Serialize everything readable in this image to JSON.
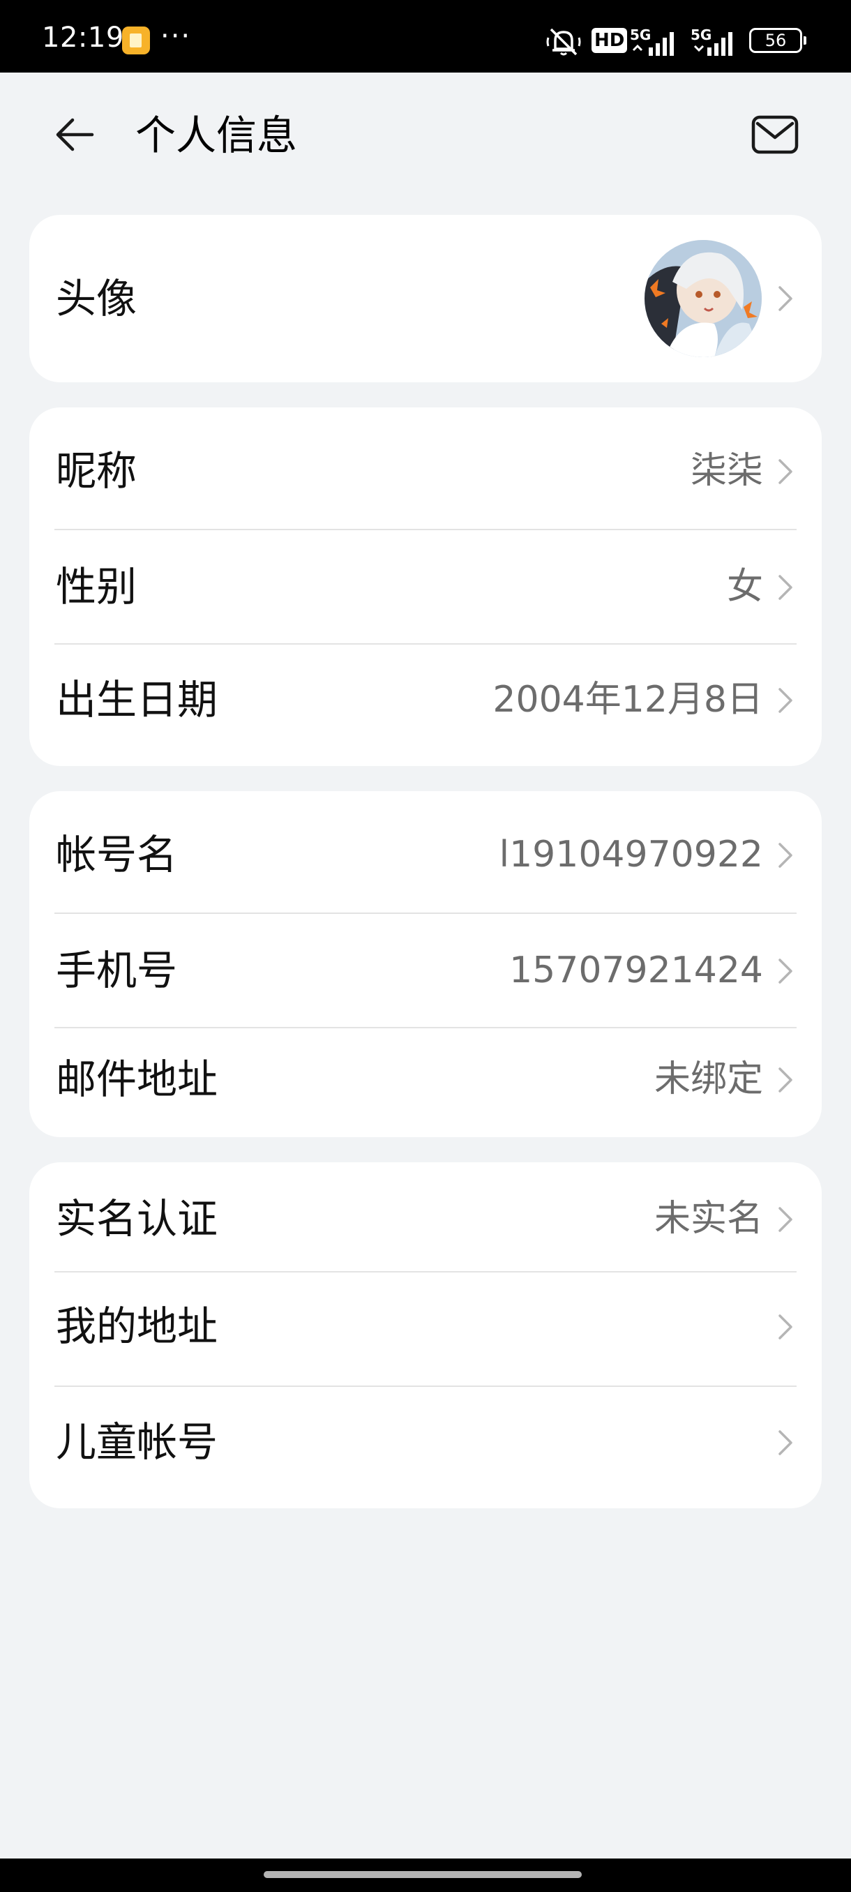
{
  "status_bar": {
    "time": "12:19",
    "more": "···",
    "hd": "HD",
    "net1": "5G",
    "net2": "5G",
    "battery": "56"
  },
  "header": {
    "title": "个人信息"
  },
  "sections": {
    "avatar": {
      "label": "头像"
    },
    "profile": [
      {
        "label": "昵称",
        "value": "柒柒"
      },
      {
        "label": "性别",
        "value": "女"
      },
      {
        "label": "出生日期",
        "value": "2004年12月8日"
      }
    ],
    "account": [
      {
        "label": "帐号名",
        "value": "l19104970922"
      },
      {
        "label": "手机号",
        "value": "15707921424"
      },
      {
        "label": "邮件地址",
        "value": "未绑定"
      }
    ],
    "other": [
      {
        "label": "实名认证",
        "value": "未实名"
      },
      {
        "label": "我的地址",
        "value": ""
      },
      {
        "label": "儿童帐号",
        "value": ""
      }
    ]
  },
  "colors": {
    "background": "#f1f3f5",
    "card": "#ffffff",
    "value_text": "#6c6c6c",
    "status_bar": "#000000"
  },
  "icons": [
    "back-arrow-icon",
    "mail-icon",
    "chevron-right-icon",
    "mute-icon",
    "signal-icon"
  ]
}
